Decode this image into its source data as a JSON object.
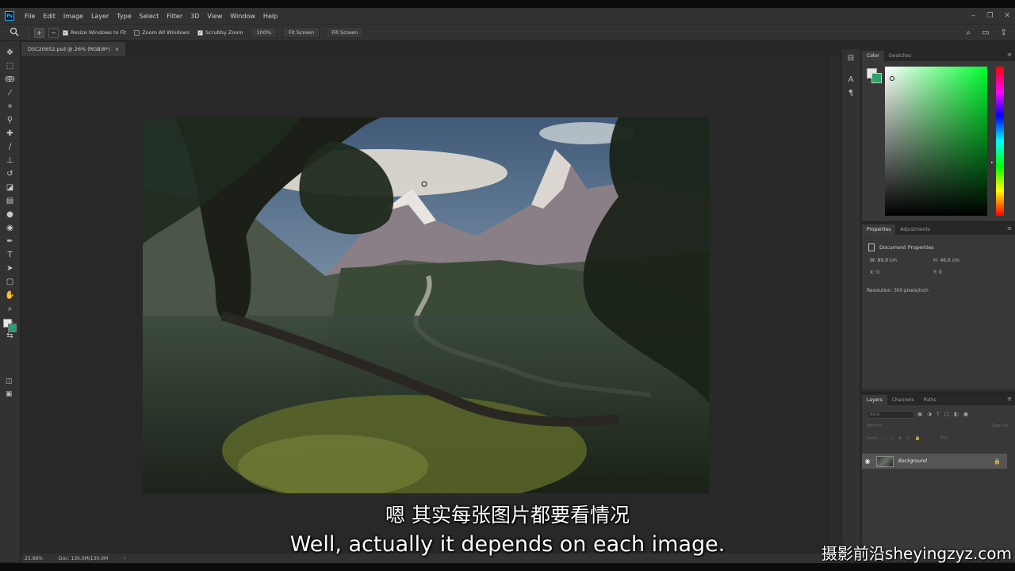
{
  "app": {
    "logo": "Ps"
  },
  "menu": [
    "File",
    "Edit",
    "Image",
    "Layer",
    "Type",
    "Select",
    "Filter",
    "3D",
    "View",
    "Window",
    "Help"
  ],
  "window_controls": {
    "minimize": "‒",
    "restore": "❐",
    "close": "✕"
  },
  "options_bar": {
    "tool_icon": "zoom-tool-icon",
    "zoom_in": "+",
    "zoom_out": "−",
    "resize_windows": "Resize Windows to Fit",
    "zoom_all": "Zoom All Windows",
    "scrubby": "Scrubby Zoom",
    "btn_100": "100%",
    "fit_screen": "Fit Screen",
    "fill_screen": "Fill Screen",
    "resize_checked": true,
    "zoom_all_checked": false,
    "scrubby_checked": true
  },
  "document": {
    "tab_title": "DSC20652.psd @ 26% (RGB/8*)",
    "tab_close": "×"
  },
  "status": {
    "zoom": "25,98%",
    "doc": "Doc: 130,0M/130,0M",
    "arrow": "›"
  },
  "color_panel": {
    "tabs": [
      "Color",
      "Swatches"
    ],
    "fg": "#e6e6e6",
    "bg": "#2ba36a"
  },
  "properties_panel": {
    "tabs": [
      "Properties",
      "Adjustments"
    ],
    "title": "Document Properties",
    "w_label": "W:",
    "w": "89,9 cm",
    "h_label": "H:",
    "h": "46,6 cm",
    "x_label": "X:",
    "x": "0",
    "y_label": "Y:",
    "y": "0",
    "resolution": "Resolution: 300 pixels/inch"
  },
  "layers_panel": {
    "tabs": [
      "Layers",
      "Channels",
      "Paths"
    ],
    "search_placeholder": "Kind",
    "blend": "Normal",
    "opacity": "Opacity:",
    "lock": "Lock:",
    "fill": "Fill:",
    "layer_name": "Background"
  },
  "subtitles": {
    "cn": "嗯 其实每张图片都要看情况",
    "en": "Well, actually it depends on each image."
  },
  "watermark": "摄影前沿sheyingzyz.com"
}
